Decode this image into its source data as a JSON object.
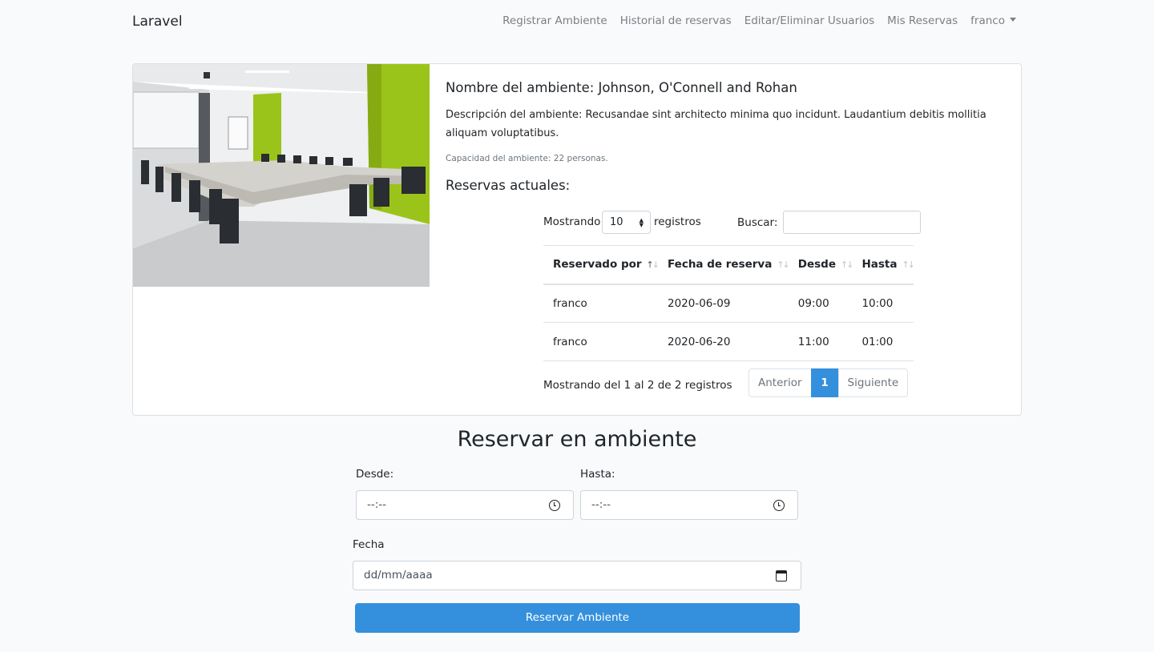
{
  "navbar": {
    "brand": "Laravel",
    "links": [
      "Registrar Ambiente",
      "Historial de reservas",
      "Editar/Eliminar Usuarios",
      "Mis Reservas"
    ],
    "user": "franco"
  },
  "room": {
    "name": "Nombre del ambiente: Johnson, O'Connell and Rohan",
    "description": "Descripción del ambiente: Recusandae sint architecto minima quo incidunt. Laudantium debitis mollitia aliquam voluptatibus.",
    "capacity": "Capacidad del ambiente: 22 personas.",
    "reservas_title": "Reservas actuales:"
  },
  "datatable": {
    "length_prefix": "Mostrando",
    "length_value": "10",
    "length_suffix": "registros",
    "search_label": "Buscar:",
    "columns": [
      "Reservado por",
      "Fecha de reserva",
      "Desde",
      "Hasta"
    ],
    "rows": [
      [
        "franco",
        "2020-06-09",
        "09:00",
        "10:00"
      ],
      [
        "franco",
        "2020-06-20",
        "11:00",
        "01:00"
      ]
    ],
    "info": "Mostrando del 1 al 2 de 2 registros",
    "pager": {
      "prev": "Anterior",
      "current": "1",
      "next": "Siguiente"
    }
  },
  "form": {
    "title": "Reservar en ambiente",
    "desde_label": "Desde:",
    "desde_value": "--:--",
    "hasta_label": "Hasta:",
    "hasta_value": "--:--",
    "fecha_label": "Fecha",
    "fecha_value": "dd/mm/aaaa",
    "submit": "Reservar Ambiente"
  },
  "colors": {
    "primary": "#3490dc",
    "background": "#f8fafc",
    "accent_wall": "#9bc41a"
  }
}
